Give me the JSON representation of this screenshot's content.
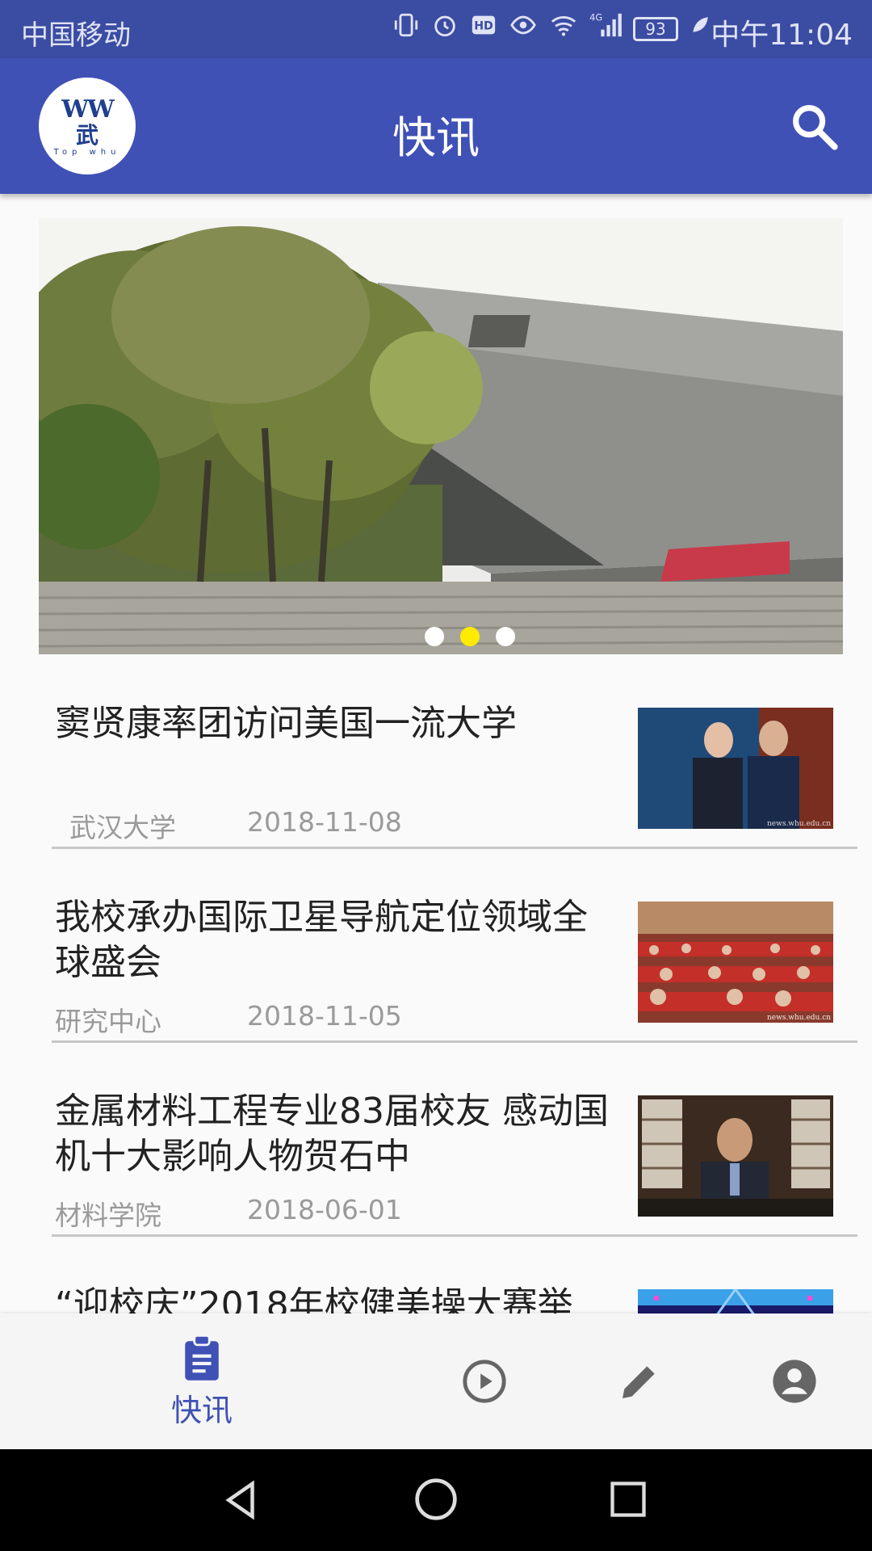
{
  "status_bar": {
    "carrier": "中国移动",
    "network": "4G",
    "battery": "93",
    "time": "中午11:04"
  },
  "app_bar": {
    "logo_text": "WW",
    "logo_char": "武",
    "logo_sub": "Top whu",
    "title": "快讯",
    "search_icon": "search-icon"
  },
  "banner": {
    "slide_count": 3,
    "active_slide": 2
  },
  "news": [
    {
      "title": "窦贤康率团访问美国一流大学",
      "source": "武汉大学",
      "date": "2018-11-08",
      "thumb_caption": "news.whu.edu.cn"
    },
    {
      "title": "我校承办国际卫星导航定位领域全球盛会",
      "source": "研究中心",
      "date": "2018-11-05",
      "thumb_caption": "news.whu.edu.cn"
    },
    {
      "title": "金属材料工程专业83届校友 感动国机十大影响人物贺石中",
      "source": "材料学院",
      "date": "2018-06-01",
      "thumb_caption": ""
    },
    {
      "title": "“迎校庆”2018年校健美操大赛举",
      "source": "",
      "date": "",
      "thumb_caption": ""
    }
  ],
  "bottom_nav": {
    "tabs": [
      {
        "label": "快讯",
        "icon": "clipboard-icon",
        "active": true
      },
      {
        "label": "",
        "icon": "play-circle-icon",
        "active": false
      },
      {
        "label": "",
        "icon": "pencil-icon",
        "active": false
      },
      {
        "label": "",
        "icon": "account-icon",
        "active": false
      }
    ]
  },
  "colors": {
    "status_bar": "#3b4ca3",
    "app_bar": "#4051b5",
    "accent": "#3f51b5",
    "active_dot": "#ffeb00",
    "inactive_icon": "#666666"
  }
}
